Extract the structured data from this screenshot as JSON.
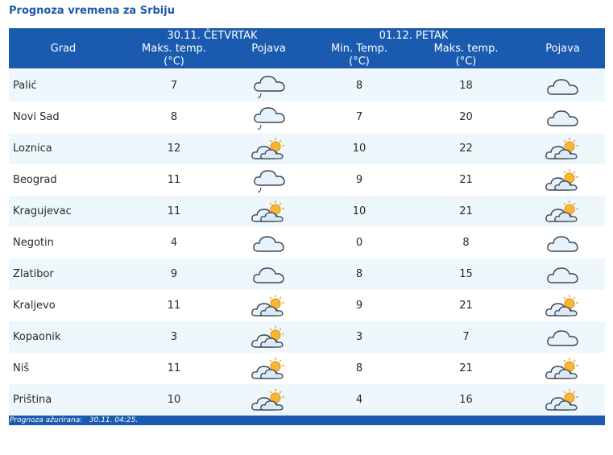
{
  "title": "Prognoza vremena za Srbiju",
  "header": {
    "day1": "30.11. ČETVRTAK",
    "day2": "01.12. PETAK",
    "city": "Grad",
    "max_temp_1": "Maks. temp.",
    "max_temp_2": "Maks. temp.",
    "min_temp": "Min. Temp.",
    "unit": "(°C)",
    "pojava_1": "Pojava",
    "pojava_2": "Pojava"
  },
  "rows": [
    {
      "city": "Palić",
      "d1_max": "7",
      "d1_icon": "rain-cloud",
      "d2_min": "8",
      "d2_max": "18",
      "d2_icon": "cloud"
    },
    {
      "city": "Novi Sad",
      "d1_max": "8",
      "d1_icon": "rain-cloud",
      "d2_min": "7",
      "d2_max": "20",
      "d2_icon": "cloud"
    },
    {
      "city": "Loznica",
      "d1_max": "12",
      "d1_icon": "partly-cloudy",
      "d2_min": "10",
      "d2_max": "22",
      "d2_icon": "partly-cloudy"
    },
    {
      "city": "Beograd",
      "d1_max": "11",
      "d1_icon": "rain-cloud",
      "d2_min": "9",
      "d2_max": "21",
      "d2_icon": "partly-cloudy"
    },
    {
      "city": "Kragujevac",
      "d1_max": "11",
      "d1_icon": "partly-cloudy",
      "d2_min": "10",
      "d2_max": "21",
      "d2_icon": "partly-cloudy"
    },
    {
      "city": "Negotin",
      "d1_max": "4",
      "d1_icon": "cloud",
      "d2_min": "0",
      "d2_max": "8",
      "d2_icon": "cloud"
    },
    {
      "city": "Zlatibor",
      "d1_max": "9",
      "d1_icon": "cloud",
      "d2_min": "8",
      "d2_max": "15",
      "d2_icon": "cloud"
    },
    {
      "city": "Kraljevo",
      "d1_max": "11",
      "d1_icon": "partly-cloudy",
      "d2_min": "9",
      "d2_max": "21",
      "d2_icon": "partly-cloudy"
    },
    {
      "city": "Kopaonik",
      "d1_max": "3",
      "d1_icon": "partly-cloudy",
      "d2_min": "3",
      "d2_max": "7",
      "d2_icon": "cloud"
    },
    {
      "city": "Niš",
      "d1_max": "11",
      "d1_icon": "partly-cloudy",
      "d2_min": "8",
      "d2_max": "21",
      "d2_icon": "partly-cloudy"
    },
    {
      "city": "Priština",
      "d1_max": "10",
      "d1_icon": "partly-cloudy",
      "d2_min": "4",
      "d2_max": "16",
      "d2_icon": "partly-cloudy"
    }
  ],
  "footer": {
    "label": "Prognoza ažurirana:",
    "timestamp": "30.11. 04:25."
  },
  "colors": {
    "header_bg": "#1a5bb0",
    "title": "#1d5aa8",
    "row_alt": "#eef8fc"
  }
}
